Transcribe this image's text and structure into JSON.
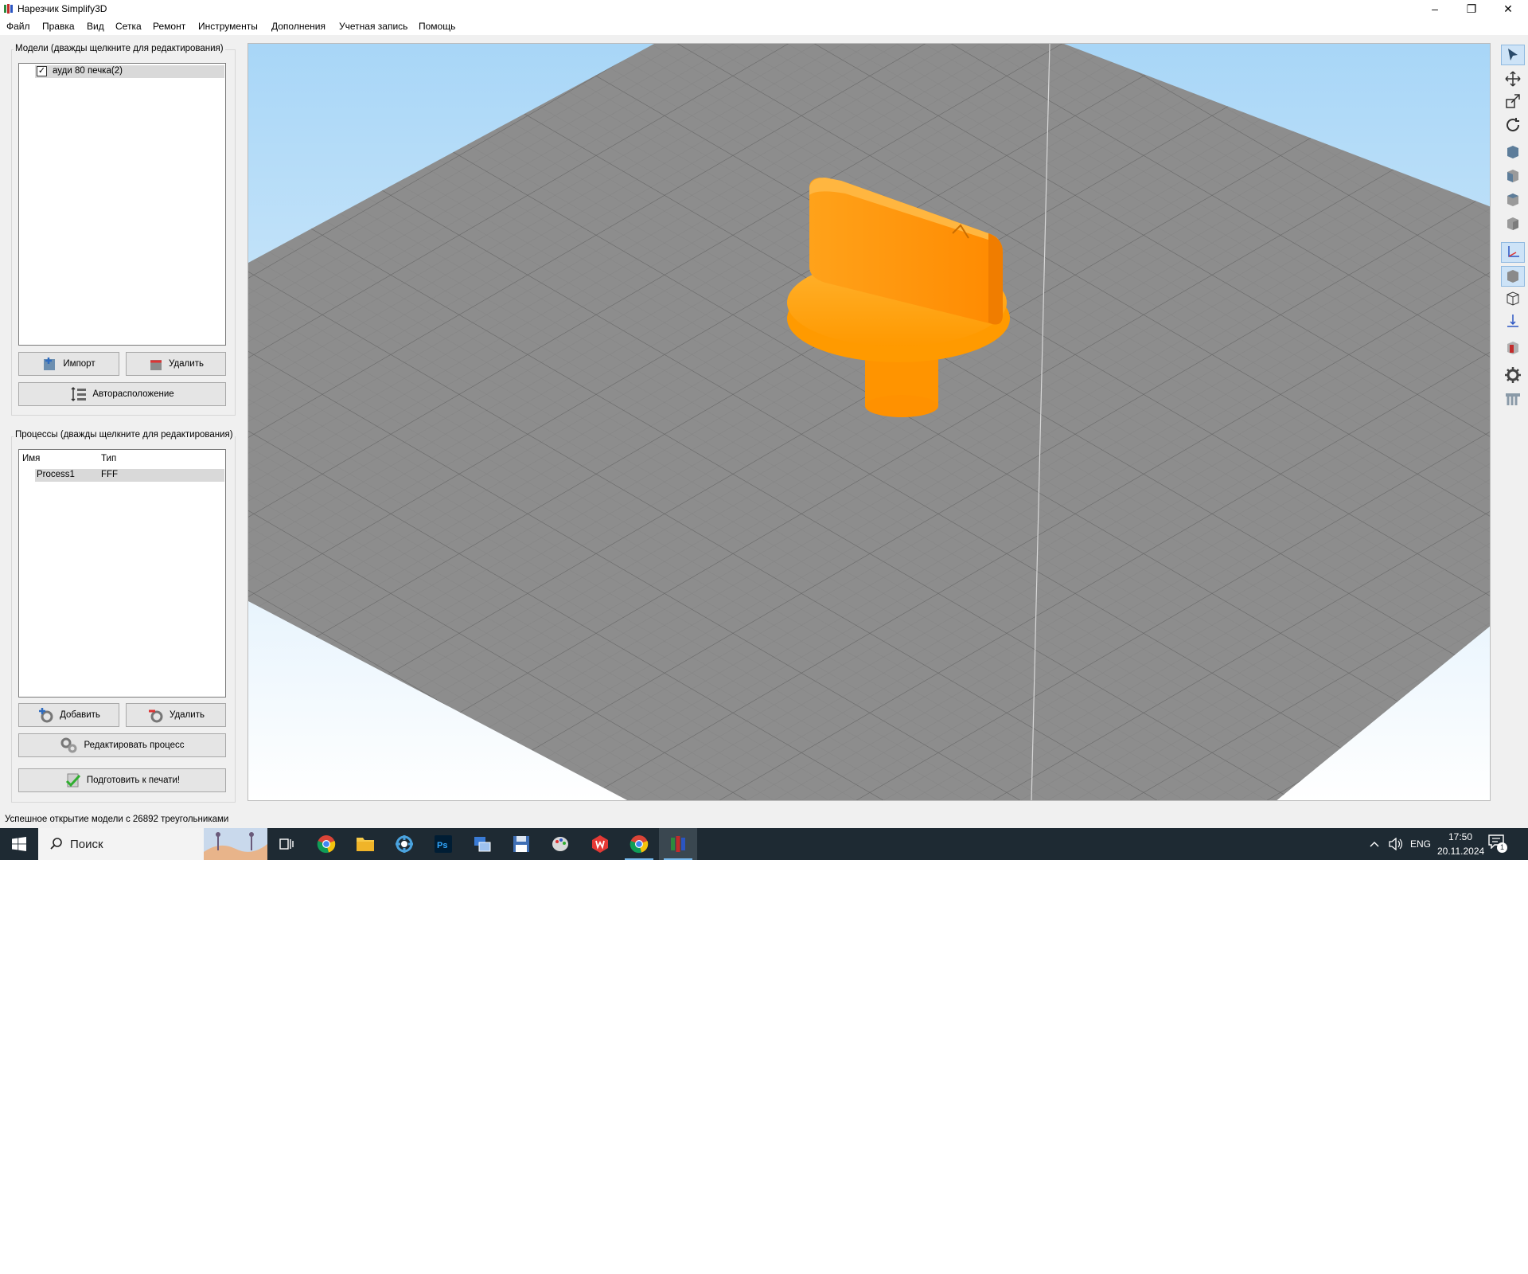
{
  "window": {
    "title": "Нарезчик Simplify3D"
  },
  "menu": [
    "Файл",
    "Правка",
    "Вид",
    "Сетка",
    "Ремонт",
    "Инструменты",
    "Дополнения",
    "Учетная запись",
    "Помощь"
  ],
  "models_panel": {
    "title": "Модели (дважды щелкните для редактирования)",
    "items": [
      {
        "label": "ауди 80 печка(2)",
        "checked": true
      }
    ],
    "import_label": "Импорт",
    "delete_label": "Удалить",
    "arrange_label": "Авторасположение"
  },
  "processes_panel": {
    "title": "Процессы (дважды щелкните для редактирования)",
    "columns": [
      "Имя",
      "Тип"
    ],
    "rows": [
      {
        "name": "Process1",
        "type": "FFF"
      }
    ],
    "add_label": "Добавить",
    "delete_label": "Удалить",
    "edit_label": "Редактировать процесс",
    "prepare_label": "Подготовить к печати!"
  },
  "viewport": {
    "model_color": "#ff9f0a",
    "sky_top": "#aad8f8",
    "bed_color": "#8c8c8c"
  },
  "toolbar_icons": [
    "select-icon",
    "move-icon",
    "scale-icon",
    "rotate-icon",
    "view-iso-icon",
    "view-front-icon",
    "view-top-icon",
    "view-side-icon",
    "axes-icon",
    "solid-view-icon",
    "wireframe-view-icon",
    "center-icon",
    "cross-section-icon",
    "settings-icon",
    "supports-icon"
  ],
  "status": {
    "text": "Успешное открытие модели с 26892 треугольниками"
  },
  "taskbar": {
    "search_placeholder": "Поиск",
    "language": "ENG",
    "time": "17:50",
    "date": "20.11.2024",
    "notification_count": "1"
  }
}
